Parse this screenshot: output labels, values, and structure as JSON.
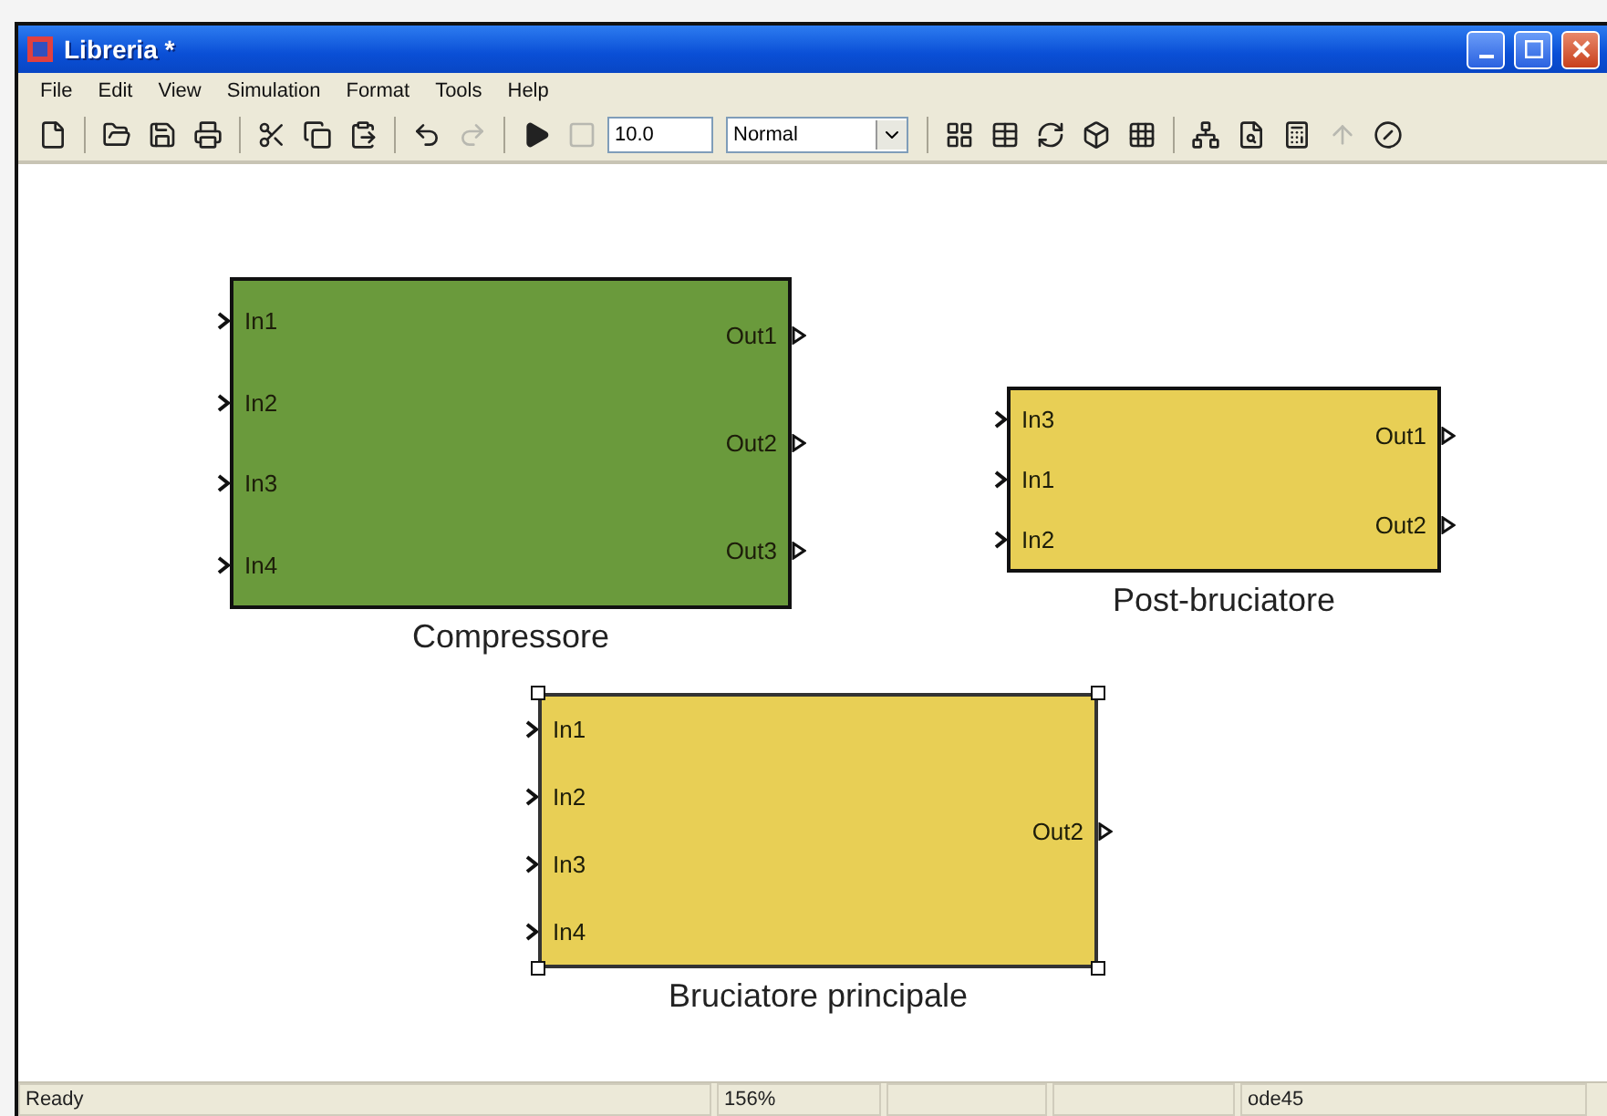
{
  "window": {
    "title": "Libreria *"
  },
  "menu": [
    "File",
    "Edit",
    "View",
    "Simulation",
    "Format",
    "Tools",
    "Help"
  ],
  "toolbar": [
    {
      "kind": "new",
      "disabled": false
    },
    {
      "kind": "sep"
    },
    {
      "kind": "open",
      "disabled": false
    },
    {
      "kind": "save",
      "disabled": false
    },
    {
      "kind": "print",
      "disabled": false
    },
    {
      "kind": "sep"
    },
    {
      "kind": "cut",
      "disabled": false
    },
    {
      "kind": "copy",
      "disabled": false
    },
    {
      "kind": "paste",
      "disabled": false
    },
    {
      "kind": "sep"
    },
    {
      "kind": "undo",
      "disabled": false
    },
    {
      "kind": "redo",
      "disabled": true
    },
    {
      "kind": "sep"
    },
    {
      "kind": "play",
      "disabled": false
    },
    {
      "kind": "stop",
      "disabled": true
    },
    {
      "kind": "field",
      "value": "10.0"
    },
    {
      "kind": "dropdown",
      "value": "Normal"
    },
    {
      "kind": "sep"
    },
    {
      "kind": "library",
      "disabled": false
    },
    {
      "kind": "table",
      "disabled": false
    },
    {
      "kind": "refresh",
      "disabled": false
    },
    {
      "kind": "model",
      "disabled": false
    },
    {
      "kind": "grid",
      "disabled": false
    },
    {
      "kind": "sep"
    },
    {
      "kind": "network",
      "disabled": false
    },
    {
      "kind": "inspect",
      "disabled": false
    },
    {
      "kind": "calculator",
      "disabled": false
    },
    {
      "kind": "up",
      "disabled": true
    },
    {
      "kind": "debug",
      "disabled": false
    }
  ],
  "blocks": [
    {
      "name": "Compressore",
      "color": "#6a9a3c",
      "selected": false,
      "inputs": [
        "In1",
        "In2",
        "In3",
        "In4"
      ],
      "outputs": [
        "Out1",
        "Out2",
        "Out3"
      ]
    },
    {
      "name": "Post-bruciatore",
      "color": "#e8cf55",
      "selected": false,
      "inputs": [
        "In3",
        "In1",
        "In2"
      ],
      "outputs": [
        "Out1",
        "Out2"
      ]
    },
    {
      "name": "Bruciatore principale",
      "color": "#e8cf55",
      "selected": true,
      "inputs": [
        "In1",
        "In2",
        "In3",
        "In4"
      ],
      "outputs": [
        "Out2"
      ]
    }
  ],
  "status_bar": {
    "status": "Ready",
    "zoom": "156%",
    "solver": "ode45"
  }
}
